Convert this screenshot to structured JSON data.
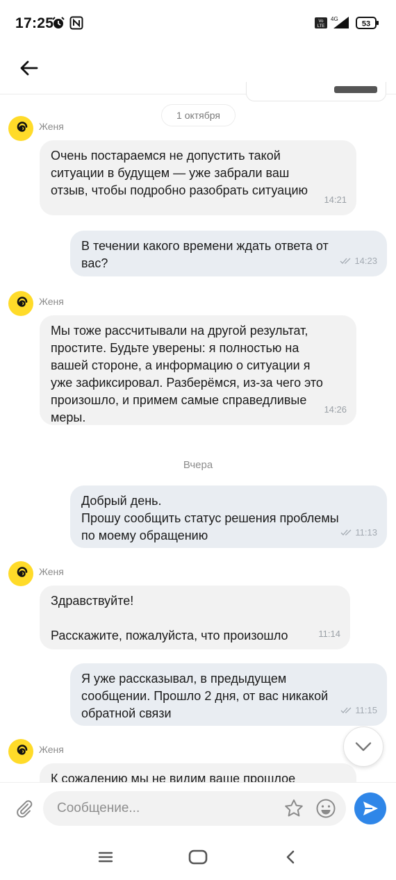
{
  "status_bar": {
    "time": "17:25",
    "network": "4G",
    "volte": "VoLTE",
    "battery": "53"
  },
  "header": {
    "back_icon": "arrow-left-icon"
  },
  "chat": {
    "date_chip": "1 октября",
    "date_divider": "Вчера",
    "sender_avatar_icon": "yandex-spiral-logo-icon",
    "messages": [
      {
        "from": "in",
        "sender": "Женя",
        "text": "Очень постараемся не допустить такой\nситуации в будущем — уже забрали ваш\nотзыв, чтобы подробно разобрать ситуацию",
        "time": "14:21"
      },
      {
        "from": "out",
        "text": "В течении какого времени ждать ответа от\nвас?",
        "time": "14:23",
        "status_icon": "double-check-icon"
      },
      {
        "from": "in",
        "sender": "Женя",
        "text": "Мы тоже рассчитывали на другой результат,\nпростите. Будьте уверены: я полностью на\nвашей стороне, а информацию о ситуации я\nуже зафиксировал. Разберёмся, из-за чего это\nпроизошло, и примем самые справедливые\nмеры.",
        "time": "14:26"
      },
      {
        "from": "out",
        "text": "Добрый день.\nПрошу сообщить статус решения проблемы\nпо моему обращению",
        "time": "11:13",
        "status_icon": "double-check-icon"
      },
      {
        "from": "in",
        "sender": "Женя",
        "text": "Здравствуйте!\n\nРасскажите, пожалуйста, что произошло",
        "time": "11:14"
      },
      {
        "from": "out",
        "text": "Я уже рассказывал, в предыдущем\nсообщении. Прошло 2 дня, от вас никакой\nобратной связи",
        "time": "11:15",
        "status_icon": "double-check-icon"
      },
      {
        "from": "in",
        "sender": "Женя",
        "text": "К сожалению мы не видим ваше прошлое",
        "time": ""
      }
    ]
  },
  "composer": {
    "placeholder": "Сообщение..."
  },
  "colors": {
    "accent": "#2f86e8",
    "avatar": "#ffdb29",
    "incoming_bubble": "#f2f2f2",
    "outgoing_bubble": "#e9edf2"
  }
}
